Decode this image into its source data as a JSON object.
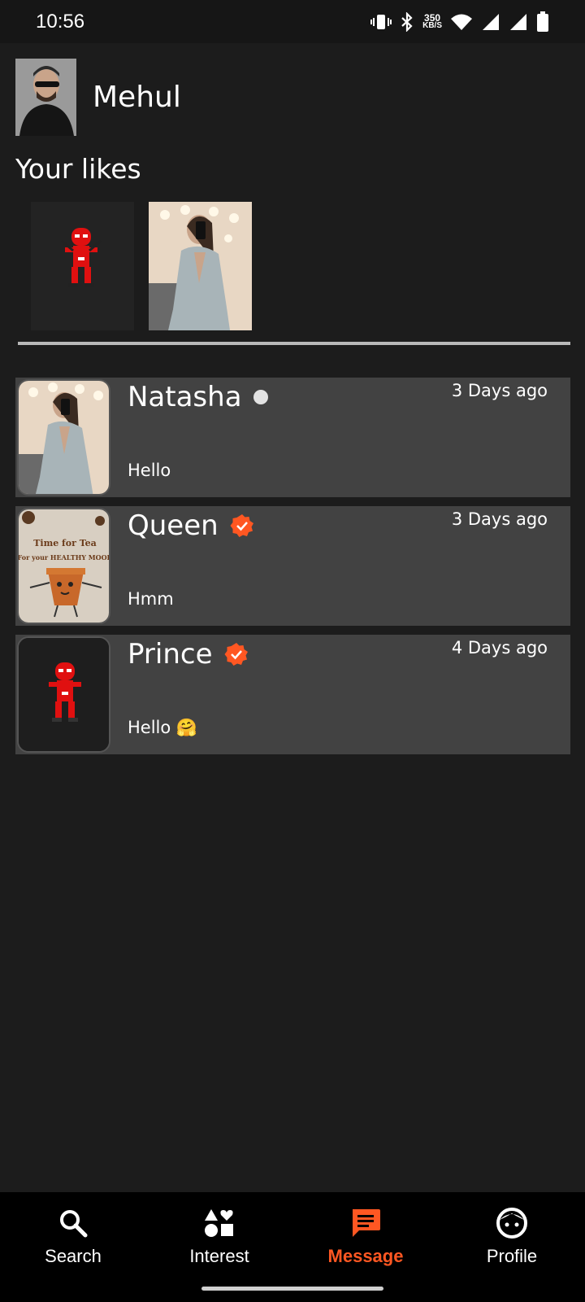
{
  "status_bar": {
    "time": "10:56",
    "net_speed_value": "350",
    "net_speed_unit": "KB/S"
  },
  "me": {
    "name": "Mehul"
  },
  "likes": {
    "title": "Your likes"
  },
  "conversations": [
    {
      "name": "Natasha",
      "message": "Hello",
      "time": "3 Days ago",
      "badge": "online-dot"
    },
    {
      "name": "Queen",
      "message": "Hmm",
      "time": "3 Days ago",
      "badge": "verified-icon",
      "avatar_text_1": "Time for Tea",
      "avatar_text_2": "For your HEALTHY MOOD"
    },
    {
      "name": "Prince",
      "message": "Hello 🤗",
      "time": "4 Days ago",
      "badge": "verified-icon"
    }
  ],
  "nav": [
    {
      "label": "Search",
      "icon": "search-icon"
    },
    {
      "label": "Interest",
      "icon": "interest-icon"
    },
    {
      "label": "Message",
      "icon": "message-icon",
      "active": true
    },
    {
      "label": "Profile",
      "icon": "profile-icon"
    }
  ],
  "colors": {
    "accent": "#ff5722",
    "card": "#424242",
    "background": "#1c1c1c"
  }
}
